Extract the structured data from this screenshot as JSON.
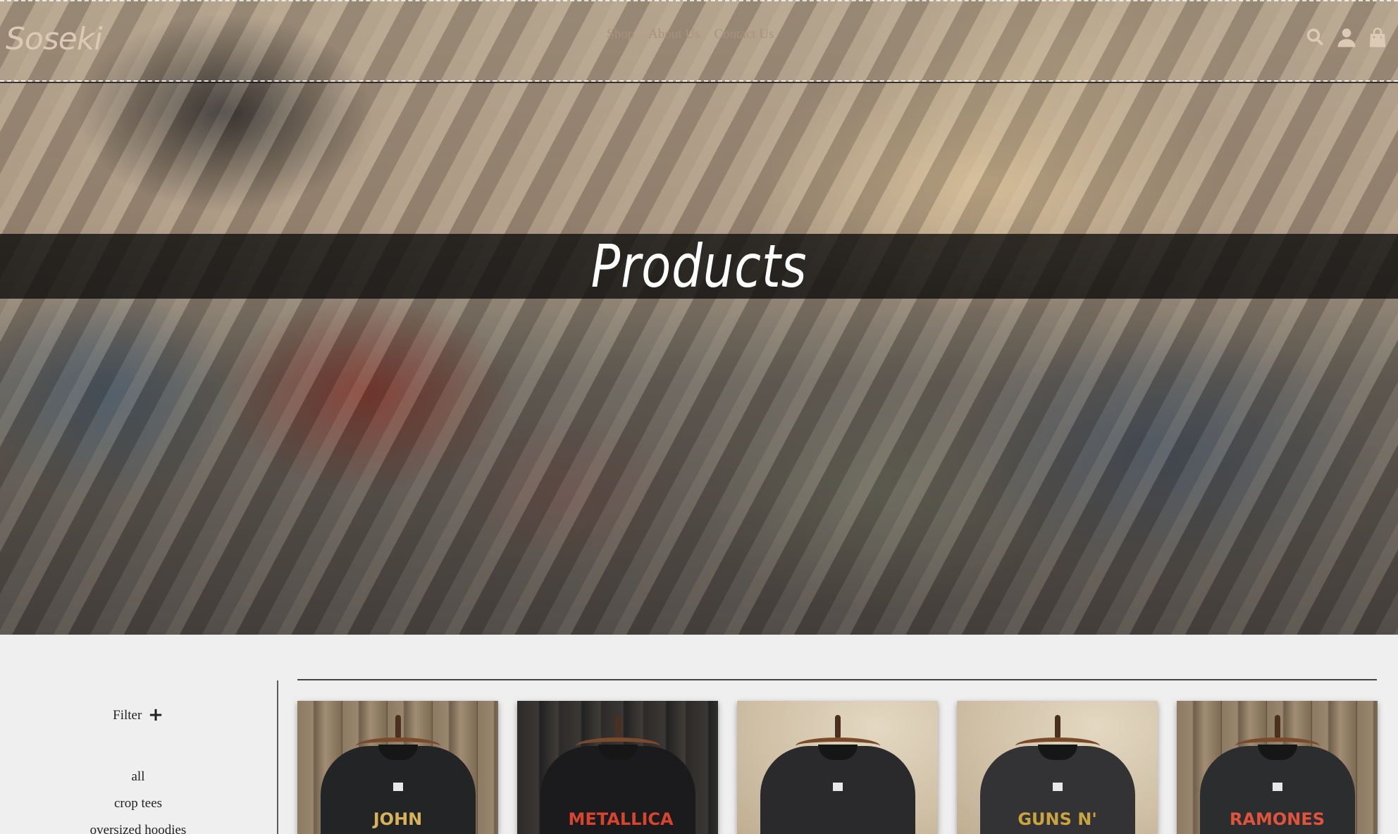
{
  "header": {
    "logo": "Soseki",
    "nav": [
      {
        "label": "Shop"
      },
      {
        "label": "About Us"
      },
      {
        "label": "Contact Us"
      }
    ],
    "icons": [
      "search-icon",
      "account-icon",
      "bag-icon"
    ]
  },
  "hero": {
    "title": "Products"
  },
  "sidebar": {
    "filter_label": "Filter",
    "filter_toggle": "+",
    "categories": [
      "all",
      "crop tees",
      "oversized hoodies"
    ]
  },
  "products": [
    {
      "print": "JOHN LENNON",
      "print_color": "#d8b25a"
    },
    {
      "print": "METALLICA",
      "print_color": "#d8452e"
    },
    {
      "print": "",
      "print_color": "#6aa0c8"
    },
    {
      "print": "GUNS N'",
      "print_color": "#c9a43f"
    },
    {
      "print": "RAMONES",
      "print_color": "#e0533c"
    }
  ],
  "colors": {
    "page_bg": "#efefef",
    "logo": "#dcc9b4",
    "nav_link": "#a8927d",
    "title_band": "#0c0c0c"
  }
}
